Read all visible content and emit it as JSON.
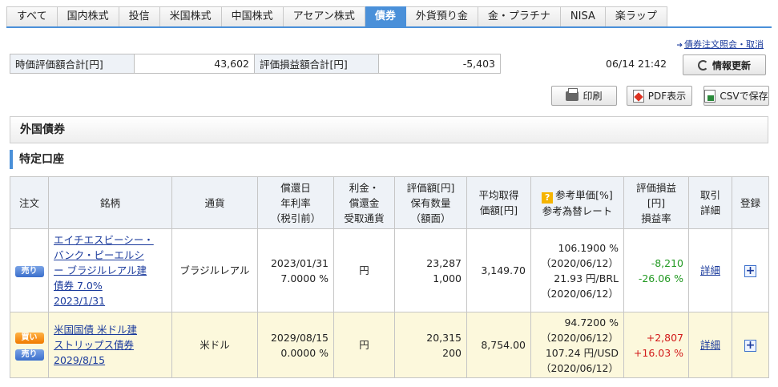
{
  "tabs": [
    {
      "label": "すべて"
    },
    {
      "label": "国内株式"
    },
    {
      "label": "投信"
    },
    {
      "label": "米国株式"
    },
    {
      "label": "中国株式"
    },
    {
      "label": "アセアン株式"
    },
    {
      "label": "債券",
      "active": true
    },
    {
      "label": "外貨預り金"
    },
    {
      "label": "金・プラチナ"
    },
    {
      "label": "NISA"
    },
    {
      "label": "楽ラップ"
    }
  ],
  "order_link": "債券注文照会・取消",
  "summary": {
    "market_value_label": "時価評価額合計[円]",
    "market_value": "43,602",
    "gain_loss_label": "評価損益額合計[円]",
    "gain_loss": "-5,403"
  },
  "timestamp": "06/14 21:42",
  "buttons": {
    "refresh": "情報更新",
    "print": "印刷",
    "pdf": "PDF表示",
    "csv": "CSVで保存"
  },
  "section_title": "外国債券",
  "account_title": "特定口座",
  "table": {
    "headers": {
      "order": "注文",
      "name": "銘柄",
      "currency": "通貨",
      "redeem_1": "償還日",
      "redeem_2": "年利率",
      "redeem_3": "（税引前）",
      "interest_1": "利金・",
      "interest_2": "償還金",
      "interest_3": "受取通貨",
      "valuation_1": "評価額[円]",
      "valuation_2": "保有数量",
      "valuation_3": "（額面）",
      "avg_1": "平均取得",
      "avg_2": "価額[円]",
      "ref_1": "参考単価[%]",
      "ref_2": "参考為替レート",
      "gain_1": "評価損益",
      "gain_2": "[円]",
      "gain_3": "損益率",
      "detail_1": "取引",
      "detail_2": "詳細",
      "register": "登録"
    },
    "rows": [
      {
        "order_sell": "売り",
        "name_1": "エイチエスビーシー・",
        "name_2": "バンク・ピーエルシ",
        "name_3": "ー ブラジルレアル建",
        "name_4": "債券 7.0%",
        "name_date": "2023/1/31",
        "currency": "ブラジルレアル",
        "redemption_date": "2023/01/31",
        "rate": "7.0000 %",
        "receive_currency": "円",
        "valuation": "23,287",
        "quantity": "1,000",
        "avg_price": "3,149.70",
        "ref_price": "106.1900 %",
        "ref_price_date": "（2020/06/12）",
        "fx_rate": "21.93 円/BRL",
        "fx_date": "（2020/06/12）",
        "gain": "-8,210",
        "gain_pct": "-26.06 %",
        "detail": "詳細"
      },
      {
        "order_buy": "買い",
        "order_sell": "売り",
        "name_1": "米国国債 米ドル建",
        "name_2": "ストリップス債券",
        "name_date": "2029/8/15",
        "currency": "米ドル",
        "redemption_date": "2029/08/15",
        "rate": "0.0000 %",
        "receive_currency": "円",
        "valuation": "20,315",
        "quantity": "200",
        "avg_price": "8,754.00",
        "ref_price": "94.7200 %",
        "ref_price_date": "（2020/06/12）",
        "fx_rate": "107.24 円/USD",
        "fx_date": "（2020/06/12）",
        "gain": "+2,807",
        "gain_pct": "+16.03 %",
        "detail": "詳細"
      }
    ]
  },
  "colors": {
    "accent": "#4a90d9",
    "negative": "#229922",
    "positive": "#d21a1a",
    "row_highlight": "#fcf8dc"
  }
}
